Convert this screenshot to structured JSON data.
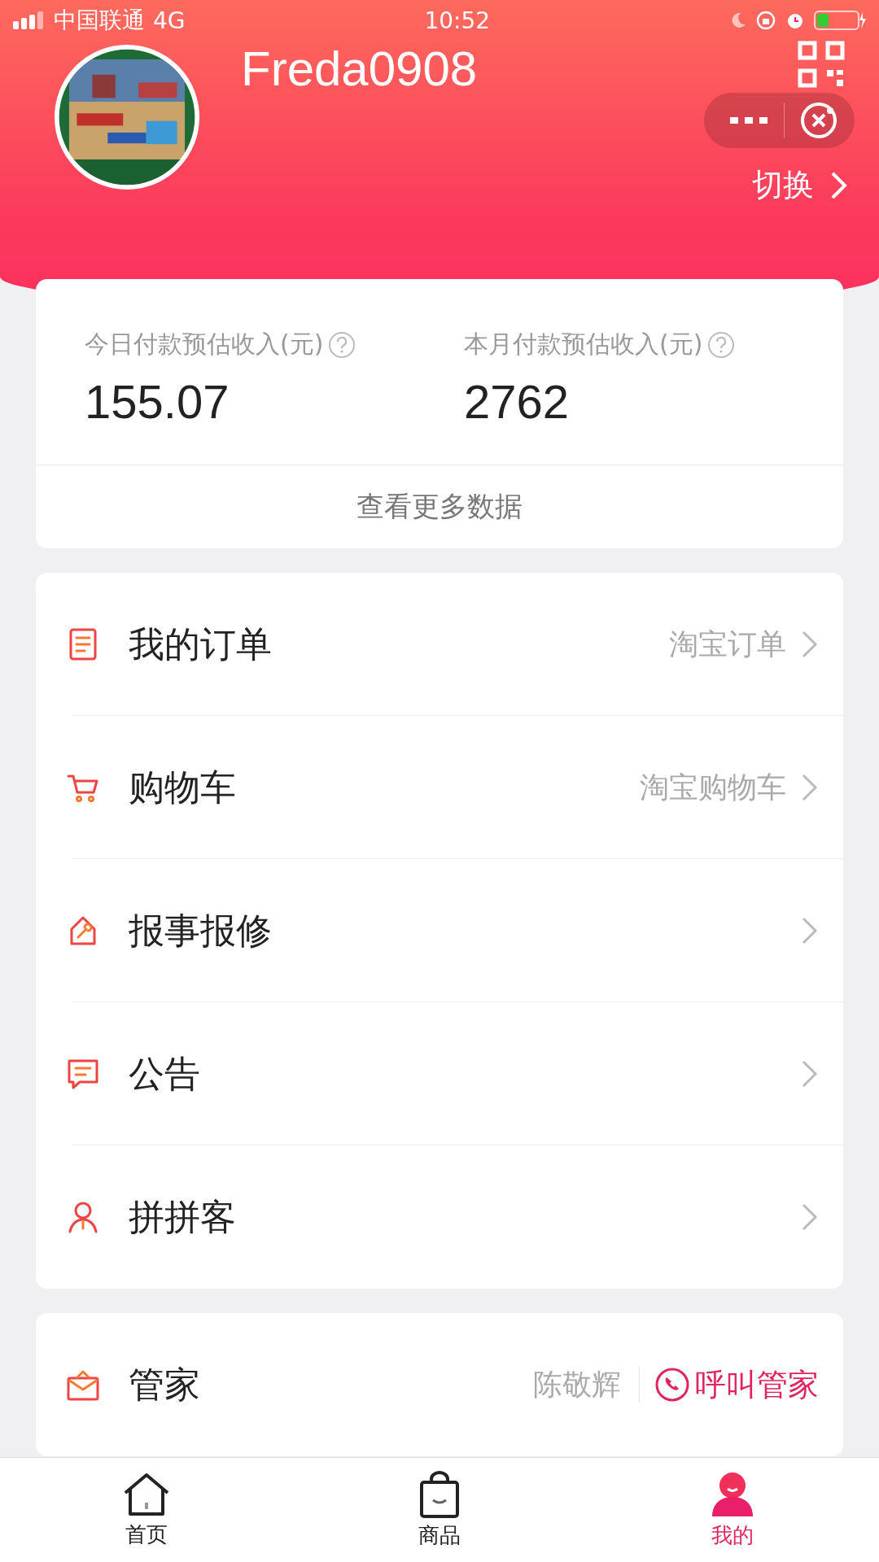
{
  "status_bar": {
    "carrier": "中国联通",
    "network": "4G",
    "time": "10:52"
  },
  "profile": {
    "name": "Freda0908",
    "switch_label": "切换"
  },
  "earnings": {
    "stats": [
      {
        "label": "今日付款预估收入(元)",
        "value": "155.07"
      },
      {
        "label": "本月付款预估收入(元)",
        "value": "2762"
      }
    ],
    "more_link": "查看更多数据"
  },
  "menu": [
    {
      "kind": "order",
      "label": "我的订单",
      "value": "淘宝订单"
    },
    {
      "kind": "cart",
      "label": "购物车",
      "value": "淘宝购物车"
    },
    {
      "kind": "repair",
      "label": "报事报修"
    },
    {
      "kind": "notice",
      "label": "公告"
    },
    {
      "kind": "person",
      "label": "拼拼客"
    }
  ],
  "butler": {
    "label": "管家",
    "name": "陈敬辉",
    "call_label": "呼叫管家"
  },
  "tab_bar": [
    {
      "kind": "home",
      "label": "首页",
      "selected": false
    },
    {
      "kind": "bag",
      "label": "商品",
      "selected": false
    },
    {
      "kind": "me",
      "label": "我的",
      "selected": true
    }
  ]
}
